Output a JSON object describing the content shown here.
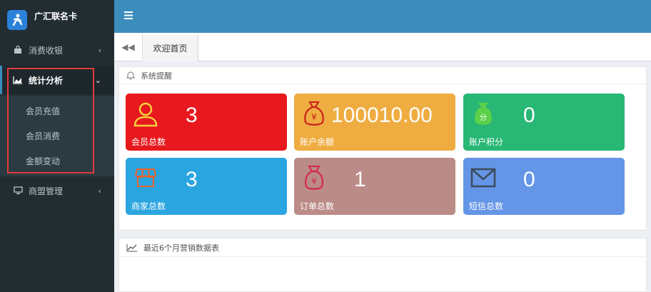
{
  "brand": {
    "title": "广汇联名卡"
  },
  "sidebar": {
    "items": [
      {
        "label": "消费收银",
        "icon": "bag-icon"
      },
      {
        "label": "统计分析",
        "icon": "chart-area-icon"
      },
      {
        "label": "商盟管理",
        "icon": "monitor-icon"
      }
    ],
    "submenu": [
      "会员充值",
      "会员消费",
      "金额变动"
    ]
  },
  "header": {
    "menu_icon": "hamburger-icon"
  },
  "tabs": {
    "home": "欢迎首页"
  },
  "reminder": {
    "title": "系统提醒",
    "cards": [
      {
        "label": "会员总数",
        "value": "3",
        "color": "#e8191e",
        "icon": "user-icon"
      },
      {
        "label": "账户余额",
        "value": "100010.00",
        "color": "#efac40",
        "icon": "money-bag-icon"
      },
      {
        "label": "账户积分",
        "value": "0",
        "color": "#28b775",
        "icon": "points-bag-icon"
      },
      {
        "label": "商家总数",
        "value": "3",
        "color": "#2ba5e0",
        "icon": "shop-icon"
      },
      {
        "label": "订单总数",
        "value": "1",
        "color": "#bb8b87",
        "icon": "order-bag-icon"
      },
      {
        "label": "短信总数",
        "value": "0",
        "color": "#6495e6",
        "icon": "mail-icon"
      }
    ]
  },
  "sales": {
    "title": "最近6个月营销数据表"
  }
}
